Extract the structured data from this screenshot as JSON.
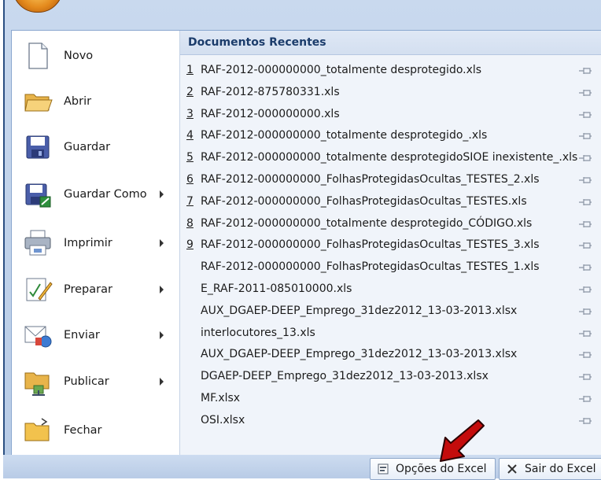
{
  "left_commands": [
    {
      "label": "Novo",
      "icon": "new-document-icon",
      "has_submenu": false
    },
    {
      "label": "Abrir",
      "icon": "open-folder-icon",
      "has_submenu": false
    },
    {
      "label": "Guardar",
      "icon": "save-disk-icon",
      "has_submenu": false
    },
    {
      "label": "Guardar Como",
      "icon": "save-as-icon",
      "has_submenu": true
    },
    {
      "label": "Imprimir",
      "icon": "printer-icon",
      "has_submenu": true
    },
    {
      "label": "Preparar",
      "icon": "prepare-pencil-icon",
      "has_submenu": true
    },
    {
      "label": "Enviar",
      "icon": "send-icon",
      "has_submenu": true
    },
    {
      "label": "Publicar",
      "icon": "publish-icon",
      "has_submenu": true
    },
    {
      "label": "Fechar",
      "icon": "close-folder-icon",
      "has_submenu": false
    }
  ],
  "recent": {
    "title": "Documentos Recentes",
    "items": [
      {
        "num": "1",
        "name": "RAF-2012-000000000_totalmente desprotegido.xls"
      },
      {
        "num": "2",
        "name": "RAF-2012-875780331.xls"
      },
      {
        "num": "3",
        "name": "RAF-2012-000000000.xls"
      },
      {
        "num": "4",
        "name": "RAF-2012-000000000_totalmente desprotegido_.xls"
      },
      {
        "num": "5",
        "name": "RAF-2012-000000000_totalmente desprotegidoSIOE inexistente_.xls"
      },
      {
        "num": "6",
        "name": "RAF-2012-000000000_FolhasProtegidasOcultas_TESTES_2.xls"
      },
      {
        "num": "7",
        "name": "RAF-2012-000000000_FolhasProtegidasOcultas_TESTES.xls"
      },
      {
        "num": "8",
        "name": "RAF-2012-000000000_totalmente desprotegido_CÓDIGO.xls"
      },
      {
        "num": "9",
        "name": "RAF-2012-000000000_FolhasProtegidasOcultas_TESTES_3.xls"
      },
      {
        "num": "",
        "name": "RAF-2012-000000000_FolhasProtegidasOcultas_TESTES_1.xls"
      },
      {
        "num": "",
        "name": "E_RAF-2011-085010000.xls"
      },
      {
        "num": "",
        "name": "AUX_DGAEP-DEEP_Emprego_31dez2012_13-03-2013.xlsx"
      },
      {
        "num": "",
        "name": "interlocutores_13.xls"
      },
      {
        "num": "",
        "name": "AUX_DGAEP-DEEP_Emprego_31dez2012_13-03-2013.xlsx"
      },
      {
        "num": "",
        "name": "DGAEP-DEEP_Emprego_31dez2012_13-03-2013.xlsx"
      },
      {
        "num": "",
        "name": "MF.xlsx"
      },
      {
        "num": "",
        "name": "OSI.xlsx"
      }
    ]
  },
  "footer": {
    "options_label": "Opções do Excel",
    "exit_label": "Sair do Excel"
  }
}
